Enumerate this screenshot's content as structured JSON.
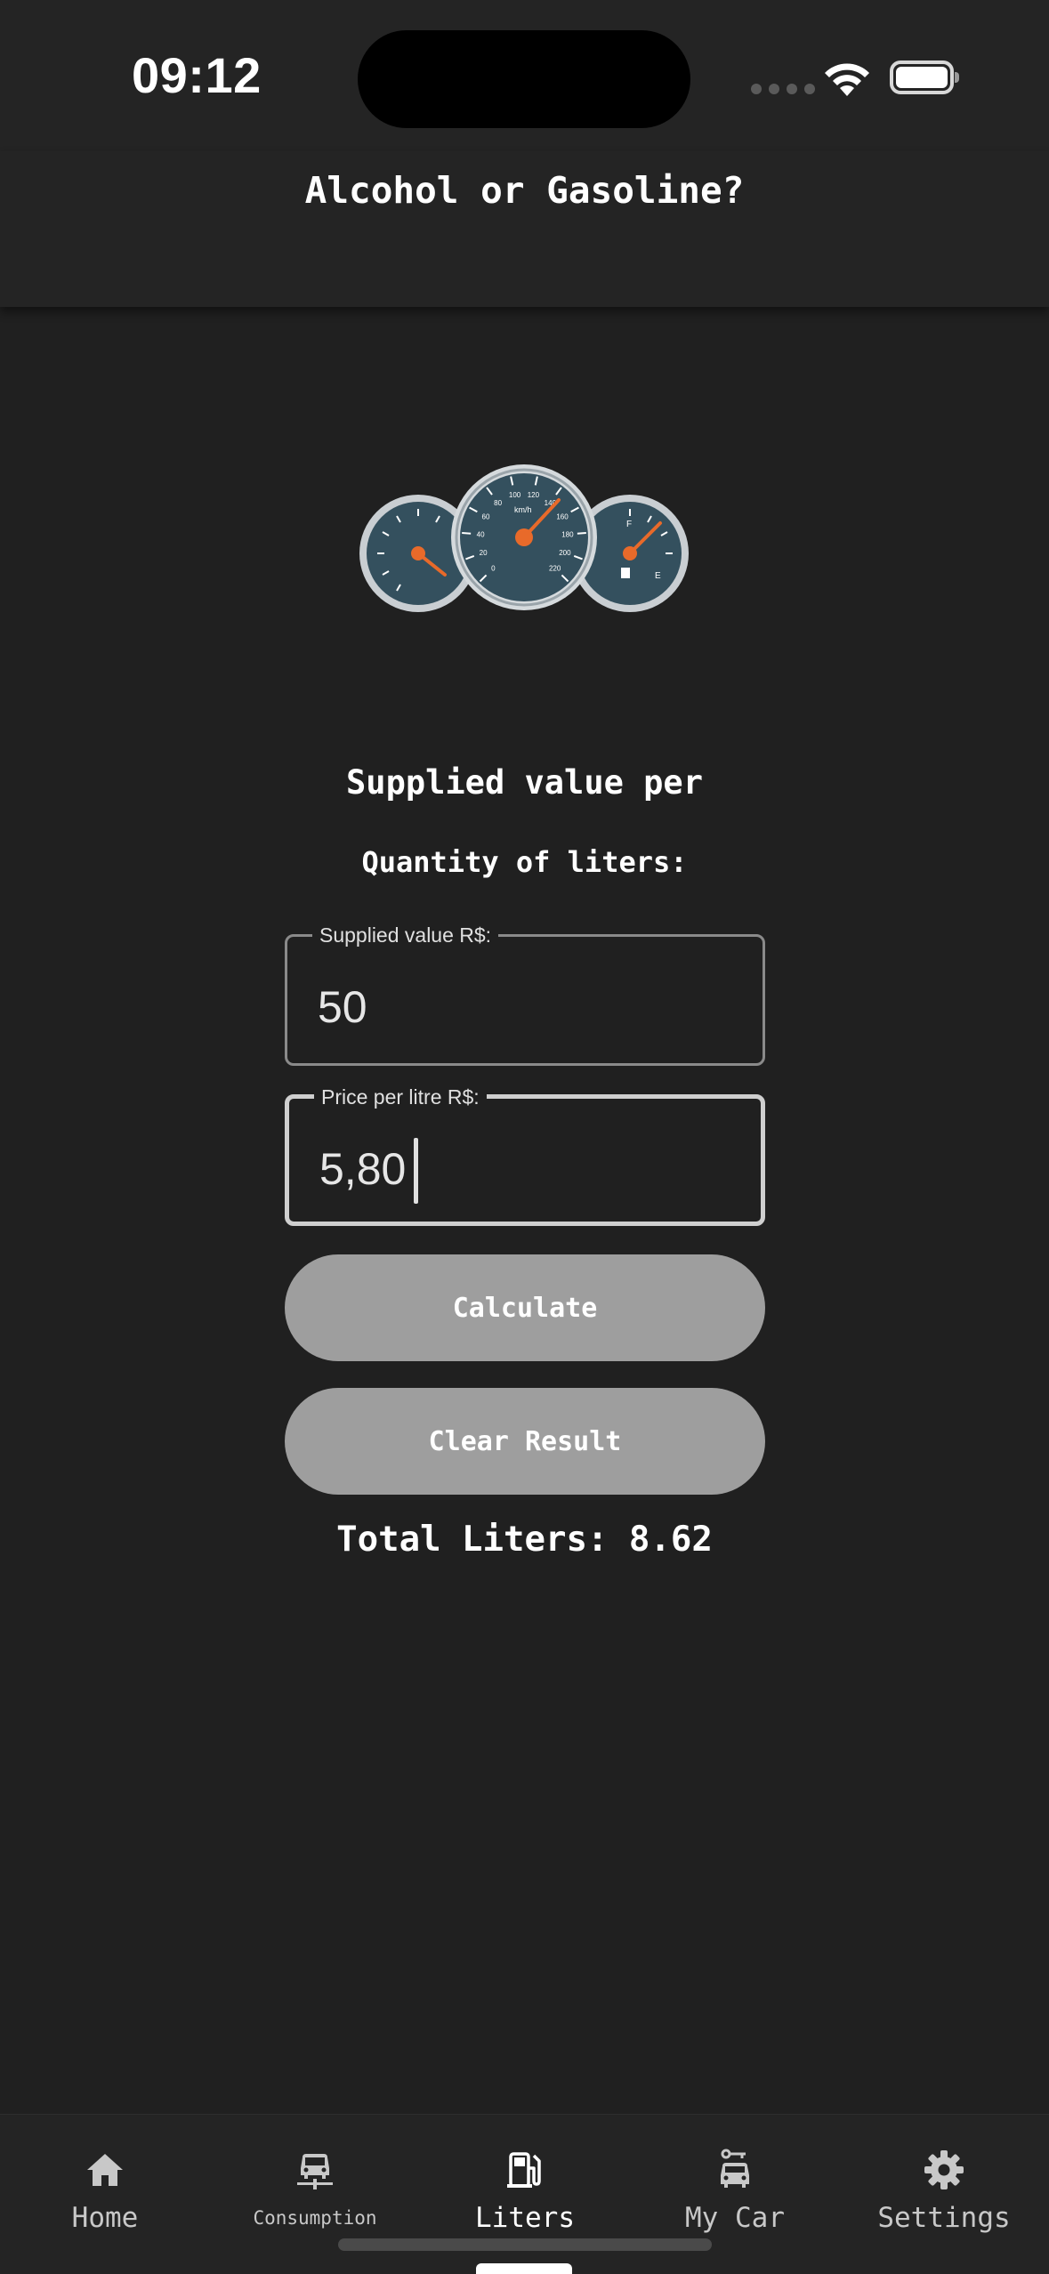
{
  "status_bar": {
    "time": "09:12"
  },
  "header": {
    "title": "Alcohol or Gasoline?"
  },
  "main": {
    "heading": "Supplied value per",
    "subheading": "Quantity of liters:",
    "supplied_field": {
      "label": "Supplied value R$:",
      "value": "50"
    },
    "price_field": {
      "label": "Price per litre R$:",
      "value": "5,80"
    },
    "calculate_label": "Calculate",
    "clear_label": "Clear Result",
    "result": "Total Liters: 8.62"
  },
  "gauge_labels": {
    "speed": [
      "0",
      "20",
      "40",
      "60",
      "80",
      "100",
      "120",
      "140",
      "160",
      "180",
      "200",
      "220"
    ],
    "speed_unit": "km/h",
    "fuel_full": "F",
    "fuel_empty": "E"
  },
  "tabs": [
    {
      "label": "Home",
      "icon": "home-icon"
    },
    {
      "label": "Consumption",
      "icon": "car-road-icon"
    },
    {
      "label": "Liters",
      "icon": "fuel-pump-icon",
      "active": true
    },
    {
      "label": "My Car",
      "icon": "car-key-icon"
    },
    {
      "label": "Settings",
      "icon": "gear-icon"
    }
  ],
  "colors": {
    "background": "#202020",
    "header": "#242424",
    "button": "#9e9e9e",
    "gauge_face": "#34505e",
    "needle": "#e86a2a"
  }
}
